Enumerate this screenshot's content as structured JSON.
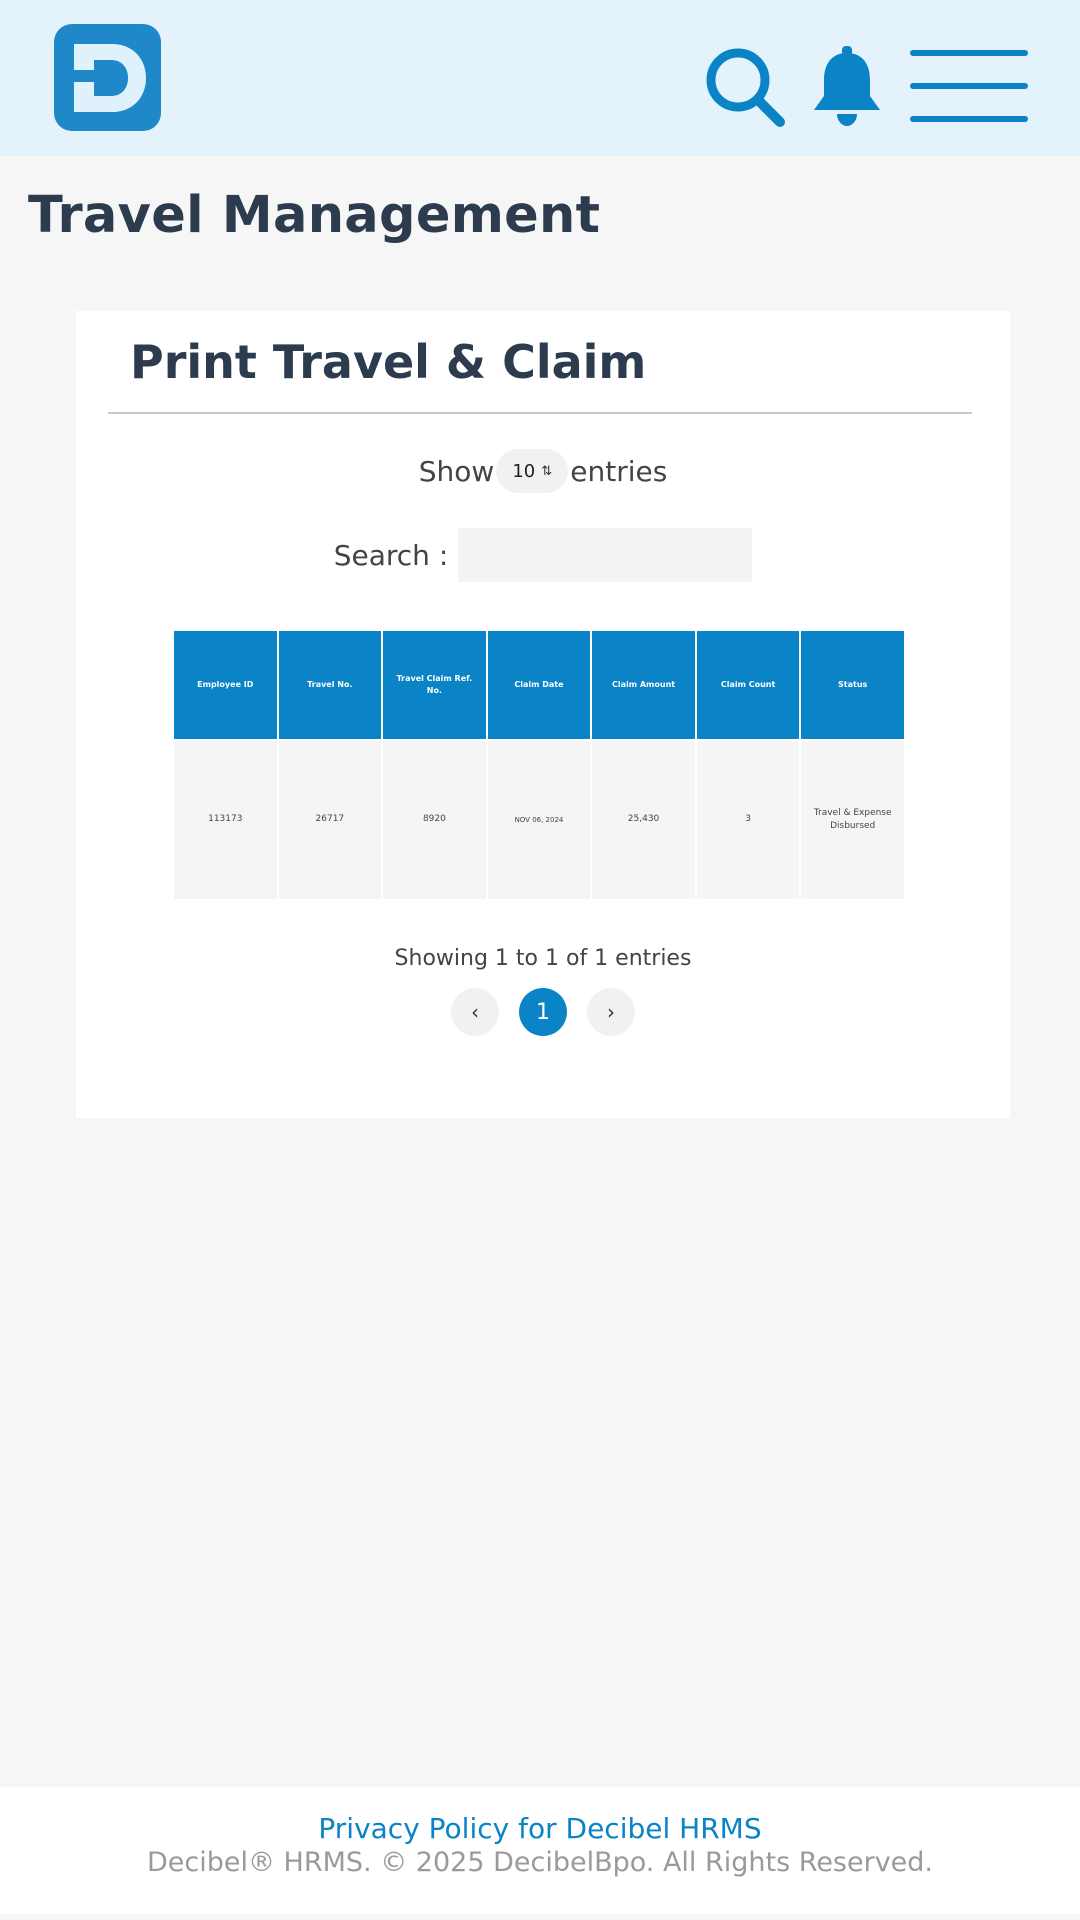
{
  "colors": {
    "brand_blue": "#0a84c6",
    "header_bg": "#e4f3fb",
    "page_bg": "#f6f6f6",
    "title_color": "#2d3b4e"
  },
  "header": {
    "logo_icon": "decibel-d-logo",
    "search_icon": "search-icon",
    "bell_icon": "bell-icon",
    "menu_icon": "hamburger-menu-icon"
  },
  "page": {
    "title": "Travel Management"
  },
  "card": {
    "title": "Print Travel & Claim",
    "length": {
      "prefix": "Show",
      "value": "10",
      "suffix": "entries"
    },
    "search": {
      "label": "Search :",
      "value": "",
      "placeholder": ""
    },
    "table": {
      "headers": [
        "Employee ID",
        "Travel No.",
        "Travel Claim Ref. No.",
        "Claim Date",
        "Claim Amount",
        "Claim Count",
        "Status"
      ],
      "rows": [
        [
          "113173",
          "26717",
          "8920",
          "NOV 06, 2024",
          "25,430",
          "3",
          "Travel & Expense Disbursed"
        ]
      ]
    },
    "info": "Showing 1 to 1 of 1 entries",
    "pagination": {
      "prev": "‹",
      "current": "1",
      "next": "›"
    }
  },
  "footer": {
    "privacy_link": "Privacy Policy for Decibel HRMS",
    "copyright": "Decibel® HRMS. © 2025 DecibelBpo. All Rights Reserved."
  }
}
